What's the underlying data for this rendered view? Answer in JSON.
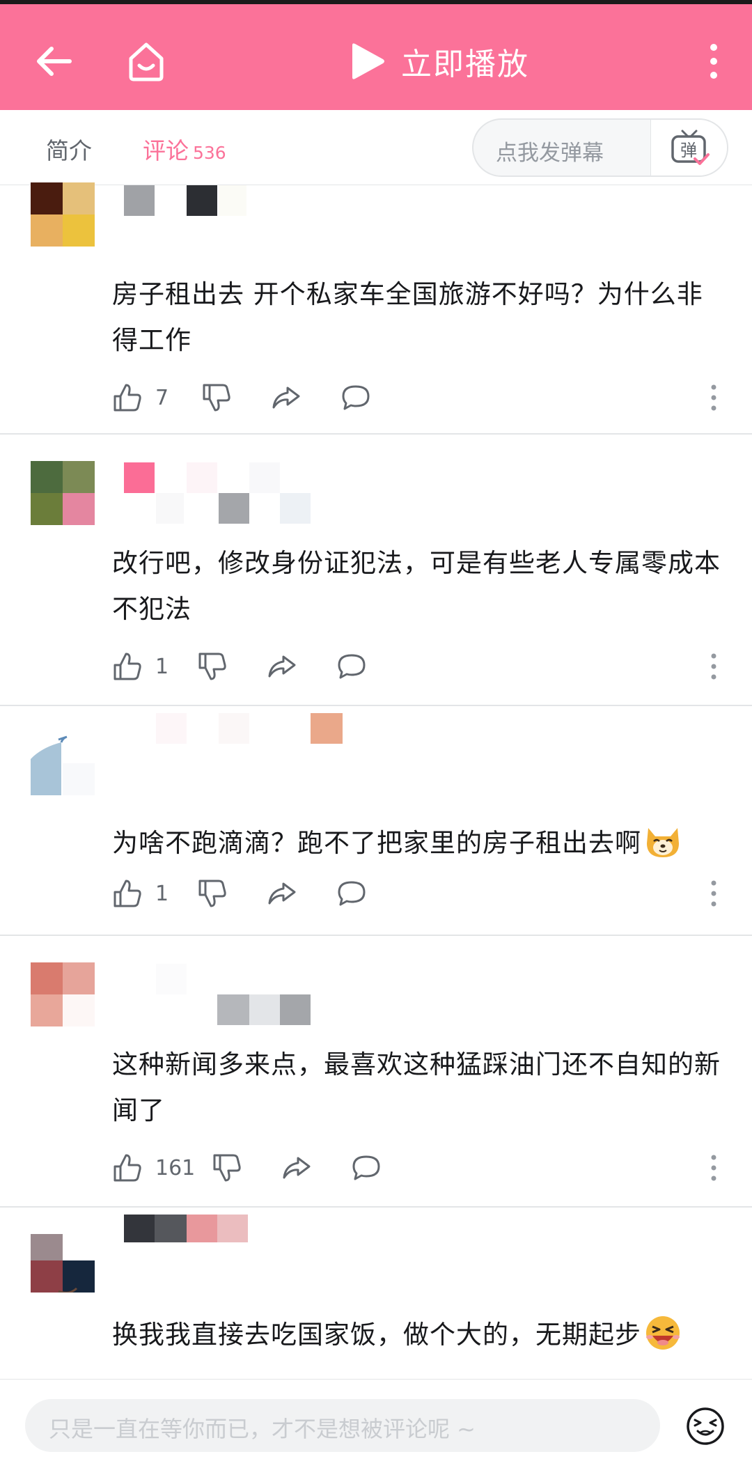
{
  "header": {
    "title": "立即播放",
    "accent_color": "#fb7299",
    "icons": [
      "back-arrow-icon",
      "home-icon",
      "play-icon",
      "more-vertical-icon"
    ]
  },
  "tabs": {
    "intro_label": "简介",
    "comments_label": "评论",
    "comments_count": "536",
    "danmaku_placeholder": "点我发弹幕",
    "danmaku_button_label": "弹"
  },
  "comments": [
    {
      "text": "房子租出去 开个私家车全国旅游不好吗？为什么非得工作",
      "likes": "7",
      "emoji": ""
    },
    {
      "text": "改行吧，修改身份证犯法，可是有些老人专属零成本不犯法",
      "likes": "1",
      "emoji": ""
    },
    {
      "text": "为啥不跑滴滴？跑不了把家里的房子租出去啊",
      "likes": "1",
      "emoji": "dog-face-emoji"
    },
    {
      "text": "这种新闻多来点，最喜欢这种猛踩油门还不自知的新闻了",
      "likes": "161",
      "emoji": ""
    },
    {
      "text": "换我我直接去吃国家饭，做个大的，无期起步",
      "likes": "",
      "emoji": "laughing-face-emoji"
    }
  ],
  "input": {
    "placeholder": "只是一直在等你而已，才不是想被评论呢 ~",
    "emoji_icon": "emoji-face-icon"
  }
}
